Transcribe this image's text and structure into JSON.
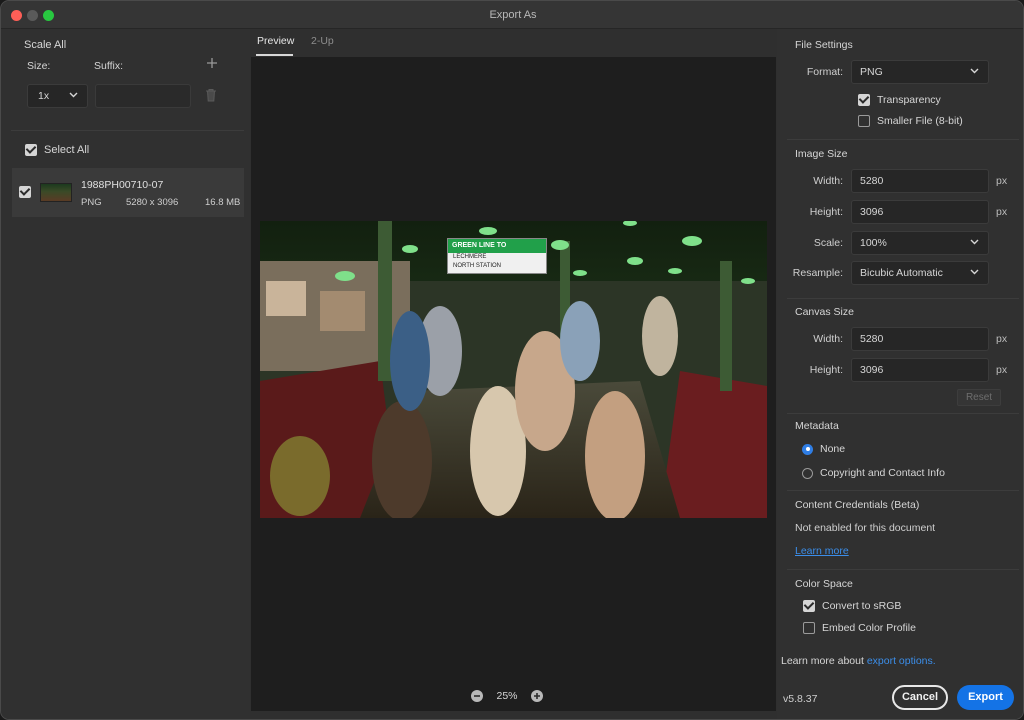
{
  "window": {
    "title": "Export As"
  },
  "left": {
    "scale_all": "Scale All",
    "size_label": "Size:",
    "suffix_label": "Suffix:",
    "size_value": "1x",
    "suffix_placeholder": "",
    "select_all": "Select All",
    "asset": {
      "name": "1988PH00710-07",
      "format": "PNG",
      "dimensions": "5280 x 3096",
      "file_size": "16.8 MB"
    }
  },
  "center": {
    "tabs": [
      {
        "label": "Preview"
      },
      {
        "label": "2-Up"
      }
    ],
    "sign": {
      "line_top": "GREEN LINE TO",
      "line1": "LECHMERE",
      "line2": "NORTH STATION"
    },
    "zoom": "25%"
  },
  "right": {
    "file_settings": {
      "title": "File Settings",
      "format_label": "Format:",
      "format_value": "PNG",
      "transparency": "Transparency",
      "smaller_file": "Smaller File (8-bit)"
    },
    "image_size": {
      "title": "Image Size",
      "width_label": "Width:",
      "width_value": "5280",
      "height_label": "Height:",
      "height_value": "3096",
      "scale_label": "Scale:",
      "scale_value": "100%",
      "resample_label": "Resample:",
      "resample_value": "Bicubic Automatic",
      "unit": "px"
    },
    "canvas_size": {
      "title": "Canvas Size",
      "width_label": "Width:",
      "width_value": "5280",
      "height_label": "Height:",
      "height_value": "3096",
      "unit": "px",
      "reset": "Reset"
    },
    "metadata": {
      "title": "Metadata",
      "none": "None",
      "copyright": "Copyright and Contact Info"
    },
    "credentials": {
      "title": "Content Credentials (Beta)",
      "status": "Not enabled for this document",
      "learn_more": "Learn more"
    },
    "color_space": {
      "title": "Color Space",
      "convert": "Convert to sRGB",
      "embed": "Embed Color Profile"
    },
    "footer": {
      "learn_more_prefix": "Learn more about ",
      "learn_more_link": "export options.",
      "version": "v5.8.37",
      "cancel": "Cancel",
      "export": "Export"
    }
  },
  "colors": {
    "accent": "#1473e6",
    "link": "#3b8eea",
    "sign_green": "#21a04a"
  }
}
